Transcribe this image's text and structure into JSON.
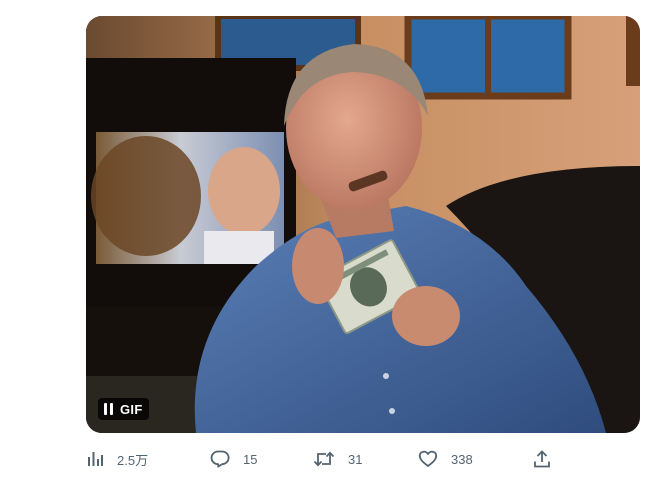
{
  "media": {
    "alt": "GIF of a man in a blue shirt holding a banknote",
    "badge_label": "GIF"
  },
  "actions": {
    "views": {
      "icon": "bar-chart-icon",
      "count": "2.5万"
    },
    "reply": {
      "icon": "speech-bubble-icon",
      "count": "15"
    },
    "retweet": {
      "icon": "retweet-arrows-icon",
      "count": "31"
    },
    "like": {
      "icon": "heart-icon",
      "count": "338"
    },
    "share": {
      "icon": "upload-arrow-icon"
    }
  },
  "colors": {
    "action_gray": "#536471",
    "badge_bg": "#000000",
    "badge_text": "#ffffff"
  }
}
